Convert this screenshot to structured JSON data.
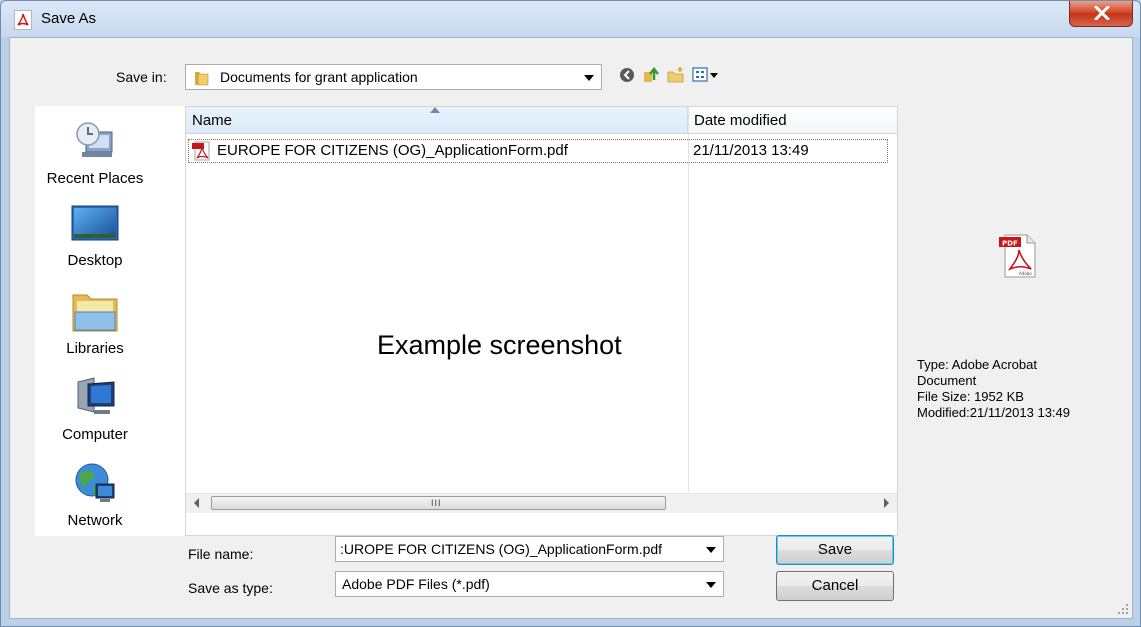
{
  "window": {
    "title": "Save As"
  },
  "save_in": {
    "label": "Save in:",
    "value": "Documents for grant application"
  },
  "places": [
    {
      "label": "Recent Places",
      "icon": "recent-places-icon"
    },
    {
      "label": "Desktop",
      "icon": "desktop-icon"
    },
    {
      "label": "Libraries",
      "icon": "libraries-icon"
    },
    {
      "label": "Computer",
      "icon": "computer-icon"
    },
    {
      "label": "Network",
      "icon": "network-icon"
    }
  ],
  "columns": {
    "name": "Name",
    "date": "Date modified"
  },
  "files": [
    {
      "name": "EUROPE FOR CITIZENS (OG)_ApplicationForm.pdf",
      "date": "21/11/2013 13:49",
      "icon": "pdf-file-icon"
    }
  ],
  "watermark": "Example screenshot",
  "scrollbar": {
    "grip": "III"
  },
  "preview": {
    "type_line1": "Type: Adobe Acrobat",
    "type_line2": "Document",
    "size": "File Size: 1952 KB",
    "modified": "Modified:21/11/2013 13:49"
  },
  "form": {
    "filename_label": "File name:",
    "filename_value": ":UROPE FOR CITIZENS (OG)_ApplicationForm.pdf",
    "type_label": "Save as type:",
    "type_value": "Adobe PDF Files (*.pdf)"
  },
  "buttons": {
    "save": "Save",
    "cancel": "Cancel"
  },
  "colors": {
    "title_bar": "#c7d9ee",
    "close": "#c33516",
    "selection_header": "#e5f0fb"
  }
}
